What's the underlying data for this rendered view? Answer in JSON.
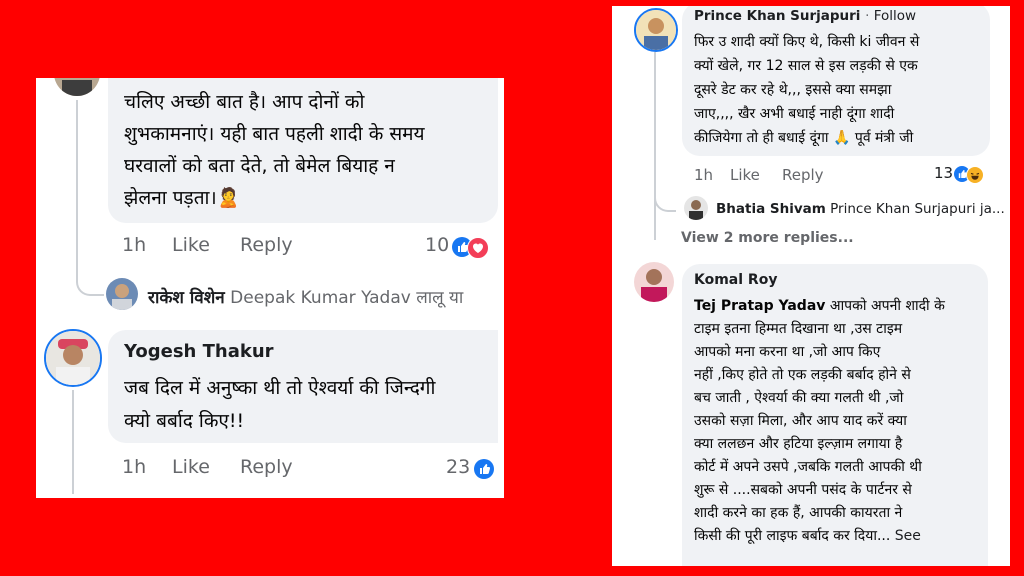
{
  "left": {
    "comment1": {
      "lines": [
        "चलिए अच्छी बात है। आप दोनों को",
        "शुभकामनाएं। यही बात पहली शादी के समय",
        "घरवालों को बता देते, तो बेमेल बियाह न",
        "झेलना पड़ता।🙎"
      ],
      "time": "1h",
      "like_label": "Like",
      "reply_label": "Reply",
      "reaction_count": "10",
      "reaction_icons": [
        "like-icon",
        "love-icon"
      ]
    },
    "reply1": {
      "author": "राकेश विशेन",
      "snippet": "Deepak Kumar Yadav लालू या"
    },
    "comment2": {
      "author": "Yogesh Thakur",
      "lines": [
        "जब दिल में अनुष्का थी तो ऐश्वर्या की जिन्दगी",
        "क्यो बर्बाद  किए!!"
      ],
      "time": "1h",
      "like_label": "Like",
      "reply_label": "Reply",
      "reaction_count": "23",
      "reaction_icons": [
        "like-icon"
      ]
    }
  },
  "right": {
    "comment1": {
      "author": "Prince Khan Surjapuri",
      "follow_label": "Follow",
      "lines": [
        "फिर उ शादी क्यों किए थे, किसी ki जीवन से",
        "क्यों खेले, गर 12 साल से इस लड़की से एक",
        "दूसरे डेट कर रहे थे,,, इससे क्या समझा",
        "जाए,,,, खैर अभी बधाई नाही दूंगा शादी",
        "कीजियेगा तो ही बधाई दूंगा 🙏  पूर्व मंत्री जी"
      ],
      "time": "1h",
      "like_label": "Like",
      "reply_label": "Reply",
      "reaction_count": "13",
      "reaction_icons": [
        "like-icon",
        "haha-icon"
      ]
    },
    "reply1": {
      "author": "Bhatia Shivam",
      "snippet": "Prince Khan Surjapuri ja..."
    },
    "view_more": "View 2 more replies...",
    "comment2": {
      "author": "Komal Roy",
      "first_line_bold": "Tej Pratap Yadav",
      "first_line_rest": " आपको अपनी शादी के",
      "lines": [
        "टाइम इतना हिम्मत दिखाना था ,उस टाइम",
        "आपको मना करना था ,जो आप किए",
        "नहीं ,किए होते तो एक लड़की बर्बाद होने से",
        "बच जाती , ऐश्वर्या की क्या गलती थी ,जो",
        "उसको सज़ा मिला, और आप याद करें क्या",
        "क्या ललछन और हटिया इल्ज़ाम लगाया है",
        "कोर्ट में अपने उसपे ,जबकि गलती आपकी थी",
        "शुरू से ....सबको अपनी पसंद के पार्टनर से",
        "शादी करने का हक हैं, आपकी कायरता ने"
      ],
      "last_line": "किसी की पूरी लाइफ बर्बाद कर दिया...",
      "see_more": "See"
    }
  }
}
